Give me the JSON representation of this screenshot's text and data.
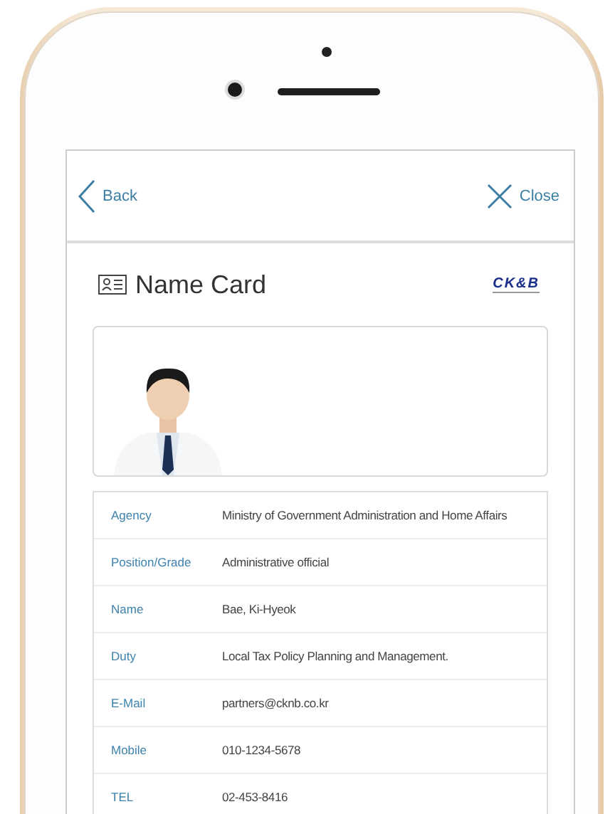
{
  "nav": {
    "back": "Back",
    "close": "Close"
  },
  "header": {
    "title": "Name Card",
    "logo": "CK&B"
  },
  "info": [
    {
      "label": "Agency",
      "value": "Ministry of Government Administration and Home Affairs"
    },
    {
      "label": "Position/Grade",
      "value": "Administrative official"
    },
    {
      "label": "Name",
      "value": "Bae, Ki-Hyeok"
    },
    {
      "label": "Duty",
      "value": "Local Tax Policy Planning and Management."
    },
    {
      "label": "E-Mail",
      "value": "partners@cknb.co.kr"
    },
    {
      "label": "Mobile",
      "value": "010-1234-5678"
    },
    {
      "label": "TEL",
      "value": "02-453-8416"
    }
  ]
}
